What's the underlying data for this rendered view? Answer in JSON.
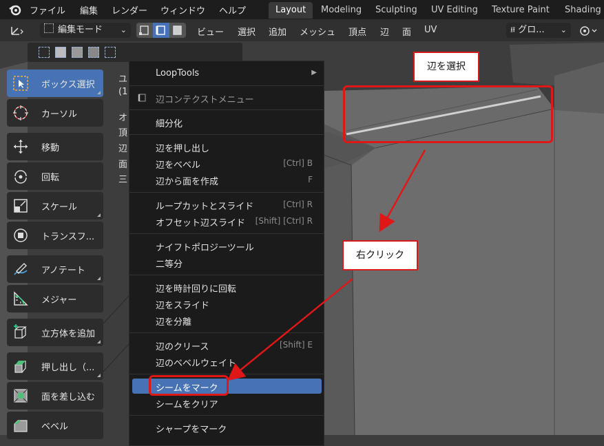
{
  "topbar": {
    "menus": [
      "ファイル",
      "編集",
      "レンダー",
      "ウィンドウ",
      "ヘルプ"
    ],
    "workspaces": [
      {
        "label": "Layout",
        "active": true
      },
      {
        "label": "Modeling",
        "active": false
      },
      {
        "label": "Sculpting",
        "active": false
      },
      {
        "label": "UV Editing",
        "active": false
      },
      {
        "label": "Texture Paint",
        "active": false
      },
      {
        "label": "Shading",
        "active": false
      }
    ]
  },
  "header": {
    "mode": "編集モード",
    "menus": [
      "ビュー",
      "選択",
      "追加",
      "メッシュ",
      "頂点",
      "辺",
      "面",
      "UV"
    ],
    "transform_orientation": "グロ..."
  },
  "toolbar": {
    "tools": [
      {
        "label": "ボックス選択",
        "icon": "box-select-icon",
        "active": true
      },
      {
        "label": "カーソル",
        "icon": "cursor-icon",
        "active": false
      },
      {
        "label": "移動",
        "icon": "move-icon",
        "active": false
      },
      {
        "label": "回転",
        "icon": "rotate-icon",
        "active": false
      },
      {
        "label": "スケール",
        "icon": "scale-icon",
        "active": false
      },
      {
        "label": "トランスフ...",
        "icon": "transform-icon",
        "active": false
      },
      {
        "label": "アノテート",
        "icon": "annotate-icon",
        "active": false
      },
      {
        "label": "メジャー",
        "icon": "measure-icon",
        "active": false
      },
      {
        "label": "立方体を追加",
        "icon": "add-cube-icon",
        "active": false
      },
      {
        "label": "押し出し（...",
        "icon": "extrude-icon",
        "active": false
      },
      {
        "label": "面を差し込む",
        "icon": "inset-icon",
        "active": false
      },
      {
        "label": "ベベル",
        "icon": "bevel-icon",
        "active": false
      }
    ]
  },
  "overlay_partial": [
    "ユ",
    "(1",
    "オ",
    "頂",
    "辺",
    "面",
    "三"
  ],
  "context_menu": {
    "title": "辺コンテクストメニュー",
    "loop_tools": "LoopTools",
    "items": {
      "subdivide": "細分化",
      "extrude_edges": "辺を押し出し",
      "bevel_edges": "辺をベベル",
      "bevel_shortcut": "[Ctrl] B",
      "face_from_edges": "辺から面を作成",
      "face_shortcut": "F",
      "loopcut_slide": "ループカットとスライド",
      "loopcut_shortcut": "[Ctrl] R",
      "offset_slide": "オフセット辺スライド",
      "offset_shortcut": "[Shift] [Ctrl] R",
      "knife_topology": "ナイフトポロジーツール",
      "bisect": "二等分",
      "rotate_cw": "辺を時計回りに回転",
      "edge_slide": "辺をスライド",
      "edge_split": "辺を分離",
      "edge_crease": "辺のクリース",
      "crease_shortcut": "[Shift] E",
      "bevel_weight": "辺のベベルウェイト",
      "mark_seam": "シームをマーク",
      "clear_seam": "シームをクリア",
      "mark_sharp": "シャープをマーク"
    }
  },
  "annotations": {
    "select_edge": "辺を選択",
    "right_click": "右クリック",
    "color": "#e01717"
  }
}
